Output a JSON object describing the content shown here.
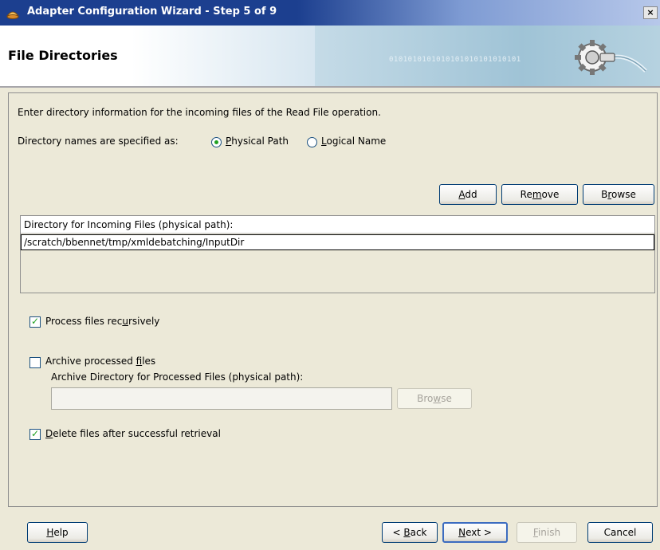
{
  "window": {
    "title": "Adapter Configuration Wizard - Step 5 of 9",
    "close_label": "×"
  },
  "banner": {
    "title": "File Directories",
    "binary_text": "0101010101010101010101010101"
  },
  "form": {
    "intro": "Enter directory information for the incoming files of the Read File operation.",
    "dir_names_label": "Directory names are specified as:",
    "radio_physical": {
      "accel": "P",
      "rest": "hysical Path",
      "selected": true
    },
    "radio_logical": {
      "accel": "L",
      "rest": "ogical Name",
      "selected": false
    },
    "buttons": {
      "add": {
        "pre": "",
        "accel": "A",
        "post": "dd"
      },
      "remove": {
        "pre": "Re",
        "accel": "m",
        "post": "ove"
      },
      "browse": {
        "pre": "B",
        "accel": "r",
        "post": "owse"
      }
    },
    "dir_table": {
      "header": "Directory for Incoming Files (physical path):",
      "rows": [
        "/scratch/bbennet/tmp/xmldebatching/InputDir"
      ]
    },
    "recursive": {
      "pre": "Process files rec",
      "accel": "u",
      "post": "rsively",
      "checked": true
    },
    "archive": {
      "pre": "Archive processed ",
      "accel": "f",
      "post": "iles",
      "checked": false
    },
    "archive_dir_label": "Archive Directory for Processed Files (physical path):",
    "archive_dir_value": "",
    "archive_browse": {
      "pre": "Bro",
      "accel": "w",
      "post": "se"
    },
    "delete": {
      "pre": "",
      "accel": "D",
      "post": "elete files after successful retrieval",
      "checked": true
    }
  },
  "footer": {
    "help": {
      "pre": "",
      "accel": "H",
      "post": "elp"
    },
    "back": {
      "pre": "< ",
      "accel": "B",
      "post": "ack"
    },
    "next": {
      "pre": "",
      "accel": "N",
      "post": "ext >"
    },
    "finish": {
      "pre": "",
      "accel": "F",
      "post": "inish"
    },
    "cancel": {
      "pre": "Cancel",
      "accel": "",
      "post": ""
    }
  },
  "colors": {
    "titlebar": "#1c3f8f",
    "dialog_bg": "#ece9d8",
    "radio_dot": "#21a121"
  }
}
